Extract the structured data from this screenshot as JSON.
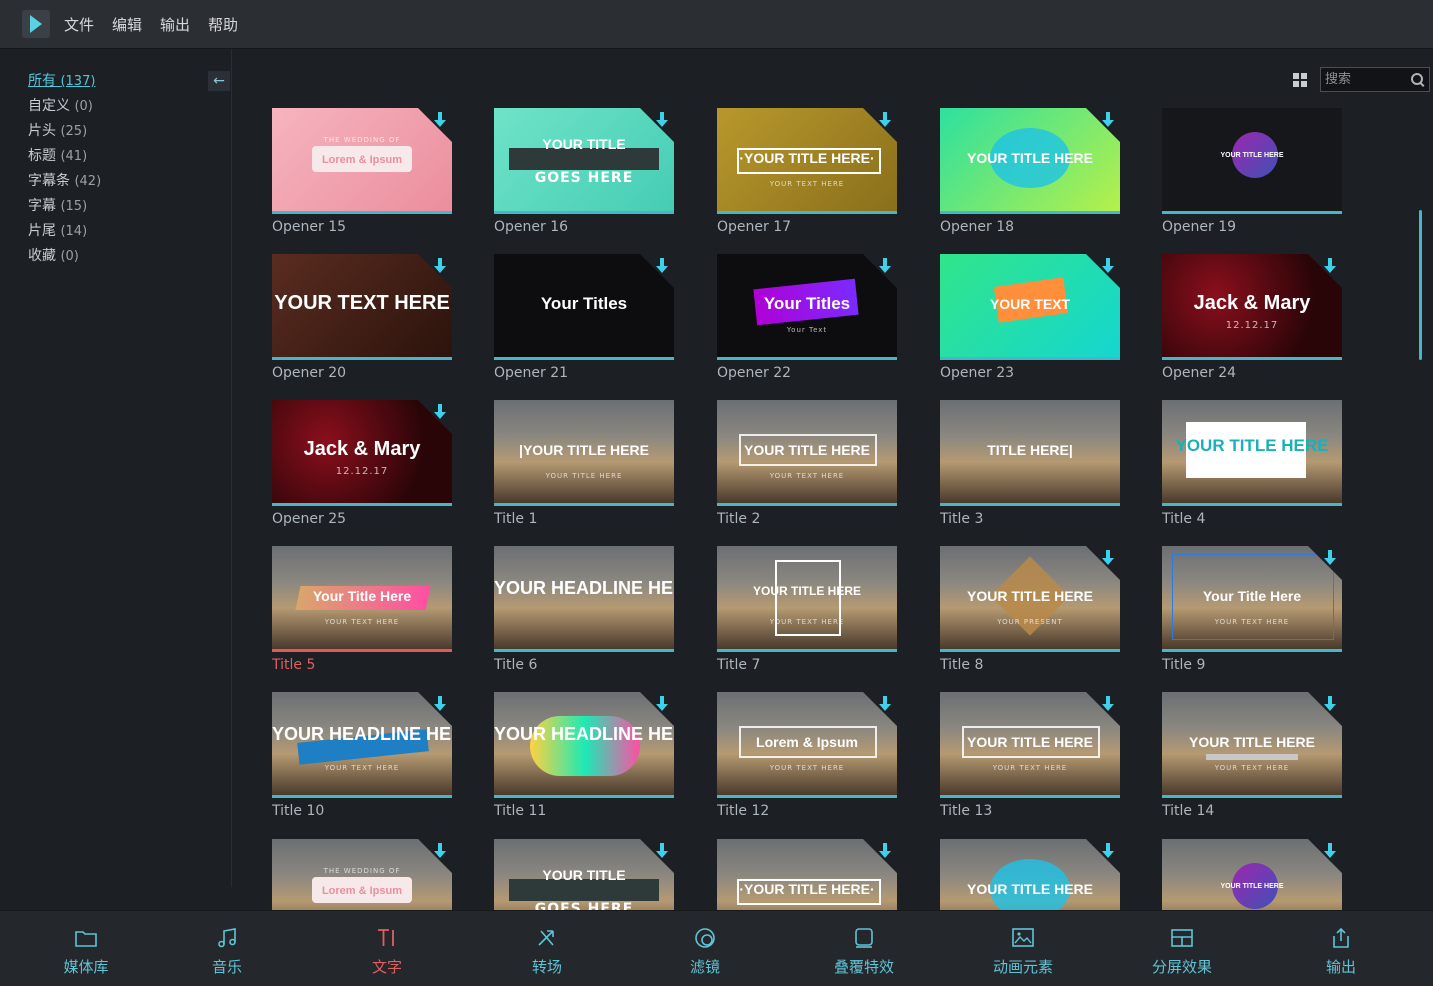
{
  "menu": [
    "文件",
    "编辑",
    "输出",
    "帮助"
  ],
  "sidebar": {
    "categories": [
      {
        "label": "所有",
        "count": "(137)",
        "active": true
      },
      {
        "label": "自定义",
        "count": "(0)"
      },
      {
        "label": "片头",
        "count": "(25)"
      },
      {
        "label": "标题",
        "count": "(41)"
      },
      {
        "label": "字幕条",
        "count": "(42)"
      },
      {
        "label": "字幕",
        "count": "(15)"
      },
      {
        "label": "片尾",
        "count": "(14)"
      },
      {
        "label": "收藏",
        "count": "(0)"
      }
    ]
  },
  "search": {
    "placeholder": "搜索"
  },
  "tiles": [
    {
      "name": "Opener 15",
      "style": "pink",
      "download": true,
      "t1": "Lorem & Ipsum",
      "t2": "THE WEDDING OF"
    },
    {
      "name": "Opener 16",
      "style": "mint",
      "download": true,
      "t1": "YOUR TITLE",
      "t2": "GOES HERE"
    },
    {
      "name": "Opener 17",
      "style": "gold",
      "download": true,
      "t1": "·YOUR TITLE HERE·",
      "t2": "YOUR TEXT HERE"
    },
    {
      "name": "Opener 18",
      "style": "green",
      "download": true,
      "t1": "YOUR TITLE HERE",
      "t2": ""
    },
    {
      "name": "Opener 19",
      "style": "dark-circle",
      "download": false,
      "t1": "YOUR TITLE HERE",
      "t2": ""
    },
    {
      "name": "Opener 20",
      "style": "wood",
      "download": true,
      "t1": "YOUR TEXT HERE",
      "t2": ""
    },
    {
      "name": "Opener 21",
      "style": "black",
      "download": true,
      "t1": "Your Titles",
      "t2": ""
    },
    {
      "name": "Opener 22",
      "style": "black-purple",
      "download": true,
      "t1": "Your Titles",
      "t2": "Your Text"
    },
    {
      "name": "Opener 23",
      "style": "green2",
      "download": true,
      "t1": "YOUR TEXT",
      "t2": ""
    },
    {
      "name": "Opener 24",
      "style": "roses",
      "download": true,
      "t1": "Jack & Mary",
      "t2": "12.12.17"
    },
    {
      "name": "Opener 25",
      "style": "roses",
      "download": true,
      "t1": "Jack & Mary",
      "t2": "12.12.17"
    },
    {
      "name": "Title 1",
      "style": "photo",
      "download": false,
      "t1": "|YOUR TITLE HERE",
      "t2": "YOUR TITLE HERE"
    },
    {
      "name": "Title 2",
      "style": "photo-box",
      "download": false,
      "t1": "YOUR TITLE HERE",
      "t2": "YOUR TEXT HERE"
    },
    {
      "name": "Title 3",
      "style": "photo",
      "download": false,
      "t1": "TITLE HERE|",
      "t2": ""
    },
    {
      "name": "Title 4",
      "style": "photo-white",
      "download": false,
      "t1": "YOUR TITLE HERE",
      "t2": ""
    },
    {
      "name": "Title 5",
      "style": "photo-ribbon",
      "download": false,
      "t1": "Your Title Here",
      "t2": "YOUR TEXT HERE",
      "selected": true
    },
    {
      "name": "Title 6",
      "style": "photo-headline",
      "download": false,
      "t1": "YOUR HEADLINE HERE",
      "t2": ""
    },
    {
      "name": "Title 7",
      "style": "photo-square",
      "download": false,
      "t1": "YOUR TITLE HERE",
      "t2": "YOUR TEXT HERE"
    },
    {
      "name": "Title 8",
      "style": "photo-diamond",
      "download": true,
      "t1": "YOUR TITLE HERE",
      "t2": "YOUR PRESENT"
    },
    {
      "name": "Title 9",
      "style": "photo-serif",
      "download": true,
      "t1": "Your Title Here",
      "t2": "YOUR TEXT HERE"
    },
    {
      "name": "Title 10",
      "style": "photo-brush",
      "download": true,
      "t1": "YOUR HEADLINE HERE",
      "t2": "YOUR TEXT HERE"
    },
    {
      "name": "Title 11",
      "style": "photo-blob",
      "download": true,
      "t1": "YOUR HEADLINE HERE",
      "t2": ""
    },
    {
      "name": "Title 12",
      "style": "photo-frame",
      "download": true,
      "t1": "Lorem & Ipsum",
      "t2": "YOUR TEXT HERE"
    },
    {
      "name": "Title 13",
      "style": "photo-gold",
      "download": true,
      "t1": "YOUR TITLE HERE",
      "t2": "YOUR TEXT HERE"
    },
    {
      "name": "Title 14",
      "style": "photo-banner",
      "download": true,
      "t1": "YOUR TITLE HERE",
      "t2": "YOUR TEXT HERE"
    },
    {
      "name": "",
      "style": "pink-photo",
      "download": true,
      "t1": "Lorem & Ipsum",
      "t2": "THE WEDDING OF"
    },
    {
      "name": "",
      "style": "mint-photo",
      "download": true,
      "t1": "YOUR TITLE",
      "t2": "GOES HERE"
    },
    {
      "name": "",
      "style": "gold-photo",
      "download": true,
      "t1": "·YOUR TITLE HERE·",
      "t2": ""
    },
    {
      "name": "",
      "style": "green-photo",
      "download": true,
      "t1": "YOUR TITLE HERE",
      "t2": ""
    },
    {
      "name": "",
      "style": "circle-photo",
      "download": true,
      "t1": "YOUR TITLE HERE",
      "t2": ""
    }
  ],
  "bottom": [
    {
      "label": "媒体库",
      "icon": "folder-icon"
    },
    {
      "label": "音乐",
      "icon": "music-icon"
    },
    {
      "label": "文字",
      "icon": "text-icon",
      "active": true
    },
    {
      "label": "转场",
      "icon": "transition-icon"
    },
    {
      "label": "滤镜",
      "icon": "filter-icon"
    },
    {
      "label": "叠覆特效",
      "icon": "overlay-icon"
    },
    {
      "label": "动画元素",
      "icon": "elements-icon"
    },
    {
      "label": "分屏效果",
      "icon": "split-screen-icon"
    },
    {
      "label": "输出",
      "icon": "export-icon"
    }
  ],
  "colors": {
    "accent": "#46b7c8",
    "selected": "#e05a5a",
    "download": "#3fd0ea"
  }
}
